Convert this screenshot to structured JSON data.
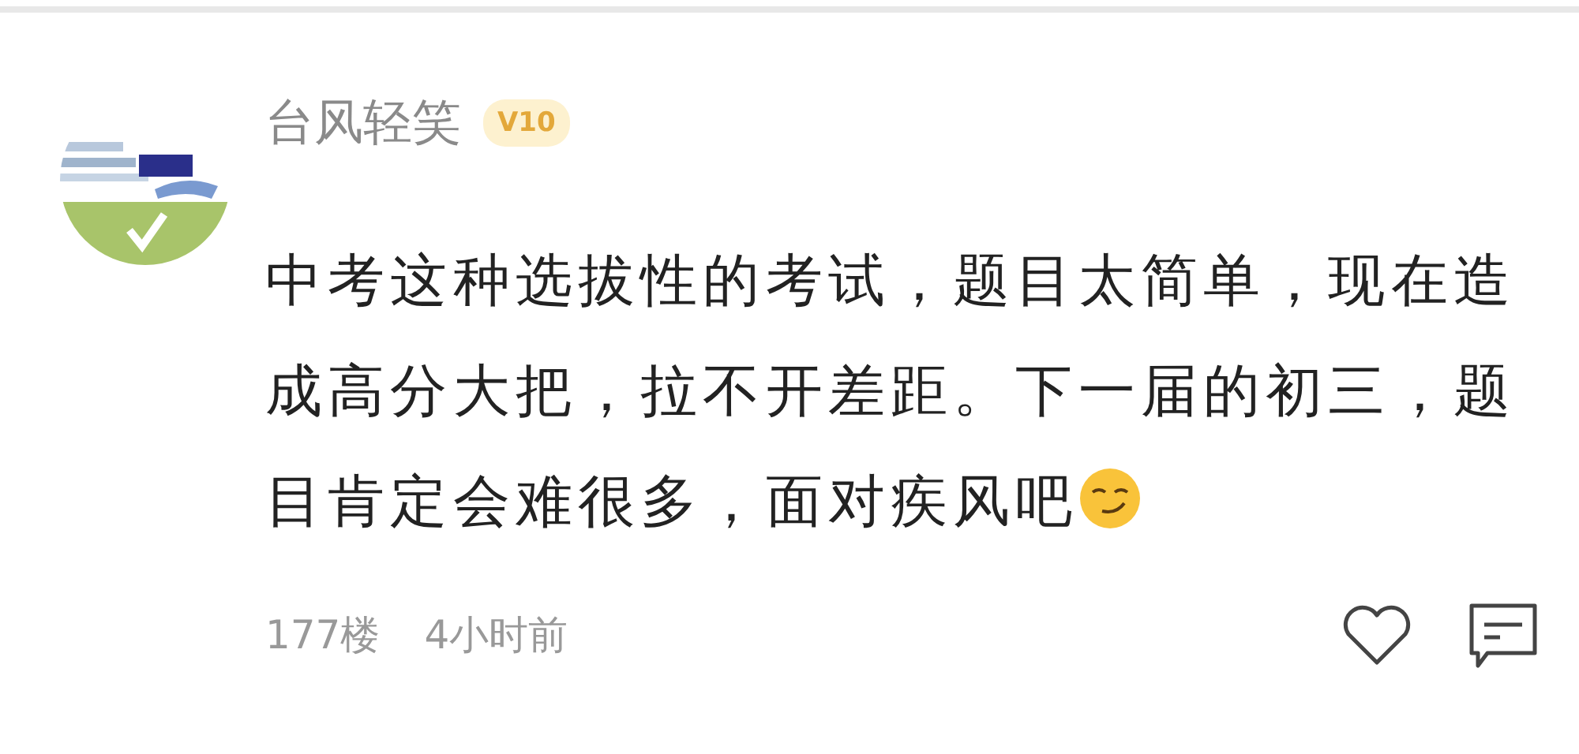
{
  "comment": {
    "author": "台风轻笑",
    "level_badge": "V10",
    "text": "中考这种选拔性的考试，题目太简单，现在造成高分大把，拉不开差距。下一届的初三，题目肯定会难很多，面对疾风吧",
    "floor": "177楼",
    "time": "4小时前"
  }
}
